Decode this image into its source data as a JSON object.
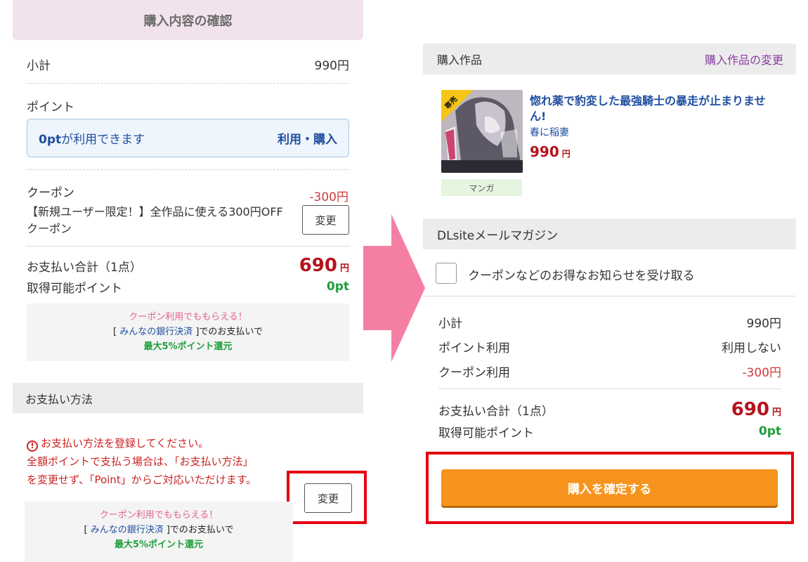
{
  "left": {
    "header": "購入内容の確認",
    "subtotal": {
      "label": "小計",
      "value": "990円"
    },
    "points": {
      "label": "ポイント",
      "available_amount": "0pt",
      "available_text": "が利用できます",
      "action": "利用・購入"
    },
    "coupon": {
      "label": "クーポン",
      "discount": "-300円",
      "description": "【新規ユーザー限定！】全作品に使える300円OFFクーポン",
      "change_button": "変更"
    },
    "total": {
      "label": "お支払い合計（1点）",
      "value": "690",
      "unit": "円"
    },
    "earnable": {
      "label": "取得可能ポイント",
      "value": "0pt"
    },
    "promo": {
      "line1": "クーポン利用でももらえる！",
      "bracket_open": "[ ",
      "link": "みんなの銀行決済",
      "line2_after": " ]でのお支払いで",
      "line3": "最大5%ポイント還元"
    },
    "payment": {
      "title": "お支払い方法",
      "warning_icon": "!",
      "warning_line1": "お支払い方法を登録してください。",
      "warning_line2": "全額ポイントで支払う場合は、「お支払い方法」",
      "warning_line3": "を変更せず、「Point」からご対応いただけます。",
      "change_button": "変更"
    },
    "promo2": {
      "line1": "クーポン利用でももらえる！",
      "bracket_open": "[ ",
      "link": "みんなの銀行決済",
      "line2_after": " ]でのお支払いで",
      "line3": "最大5%ポイント還元"
    }
  },
  "right": {
    "works_title": "購入作品",
    "works_change": "購入作品の変更",
    "product": {
      "badge": "専売",
      "title": "惚れ薬で豹変した最強騎士の暴走が止まりません!",
      "author": "春に稲妻",
      "price": "990",
      "price_unit": "円",
      "category": "マンガ"
    },
    "newsletter": {
      "title": "DLsiteメールマガジン",
      "checkbox_label": "クーポンなどのお得なお知らせを受け取る",
      "checked": false
    },
    "summary": {
      "subtotal_label": "小計",
      "subtotal_value": "990円",
      "points_label": "ポイント利用",
      "points_value": "利用しない",
      "coupon_label": "クーポン利用",
      "coupon_value": "-300円",
      "total_label": "お支払い合計（1点）",
      "total_value": "690",
      "total_unit": "円",
      "earnable_label": "取得可能ポイント",
      "earnable_value": "0pt"
    },
    "confirm_button": "購入を確定する"
  },
  "colors": {
    "accent_red": "#b5141c",
    "highlight_box": "#e60012",
    "arrow_pink": "#f47fa3",
    "confirm_orange": "#f7941d",
    "link_blue": "#1f4fa0",
    "green": "#1e9e3a"
  }
}
